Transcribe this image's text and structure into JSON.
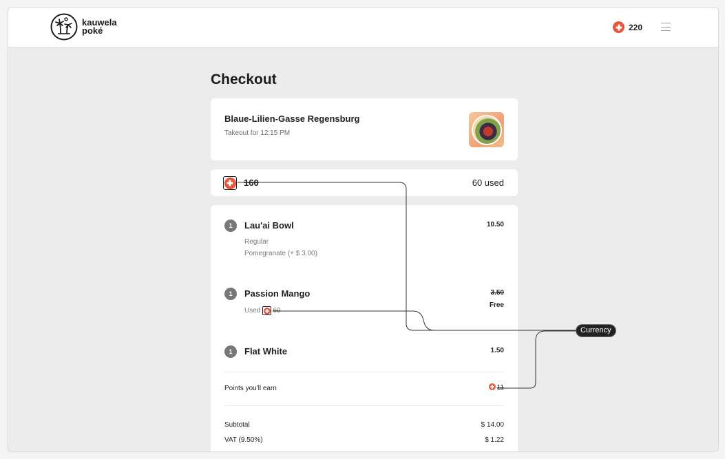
{
  "header": {
    "logo_line1": "kauwela",
    "logo_line2": "poké",
    "points_balance": "220",
    "menu_icon": "hamburger-icon",
    "points_icon": "plus-coin-icon"
  },
  "page": {
    "title": "Checkout"
  },
  "store": {
    "name": "Blaue-Lilien-Gasse Regensburg",
    "subtitle": "Takeout for 12:15 PM"
  },
  "redeem": {
    "points": "160",
    "used_label": "60 used"
  },
  "items": [
    {
      "qty": "1",
      "name": "Lau'ai Bowl",
      "price": "10.50",
      "options": [
        "Regular",
        "Pomegranate (+ $ 3.00)"
      ]
    },
    {
      "qty": "1",
      "name": "Passion Mango",
      "price": "3.50",
      "free_label": "Free",
      "used_prefix": "Used",
      "used_points": "60"
    },
    {
      "qty": "1",
      "name": "Flat White",
      "price": "1.50"
    }
  ],
  "earn": {
    "label": "Points you'll earn",
    "points": "11"
  },
  "summary": {
    "subtotal_label": "Subtotal",
    "subtotal_value": "$ 14.00",
    "vat_label": "VAT (9.50%)",
    "vat_value": "$ 1.22"
  },
  "annotation": {
    "label": "Currency"
  },
  "colors": {
    "accent": "#e8553a",
    "background": "#ececec",
    "card": "#ffffff",
    "text": "#1f1f1f"
  }
}
